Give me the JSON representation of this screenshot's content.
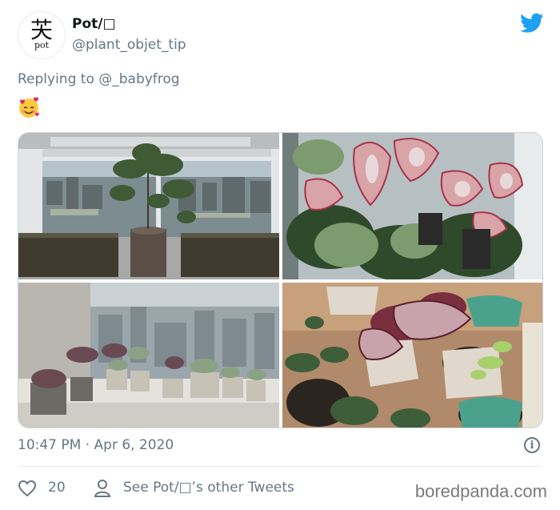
{
  "author": {
    "avatar_glyph": "芖",
    "avatar_text": "pot",
    "display_name": "Pot/□",
    "handle": "@plant_objet_tip"
  },
  "reply": {
    "prefix": "Replying to ",
    "mention": "@_babyfrog"
  },
  "body": {
    "emoji": "smiling-face-with-hearts"
  },
  "photos": [
    {
      "name": "window-tree-photo"
    },
    {
      "name": "caladium-plants-photo"
    },
    {
      "name": "succulents-windowsill-photo"
    },
    {
      "name": "potted-plants-closeup-photo"
    }
  ],
  "meta": {
    "timestamp": "10:47 PM · Apr 6, 2020",
    "info_symbol": "i"
  },
  "actions": {
    "likes": "20",
    "other_tweets": "See Pot/□’s other Tweets"
  },
  "watermark": "boredpanda.com",
  "colors": {
    "twitter_blue": "#1da1f2",
    "secondary_text": "#657786"
  }
}
